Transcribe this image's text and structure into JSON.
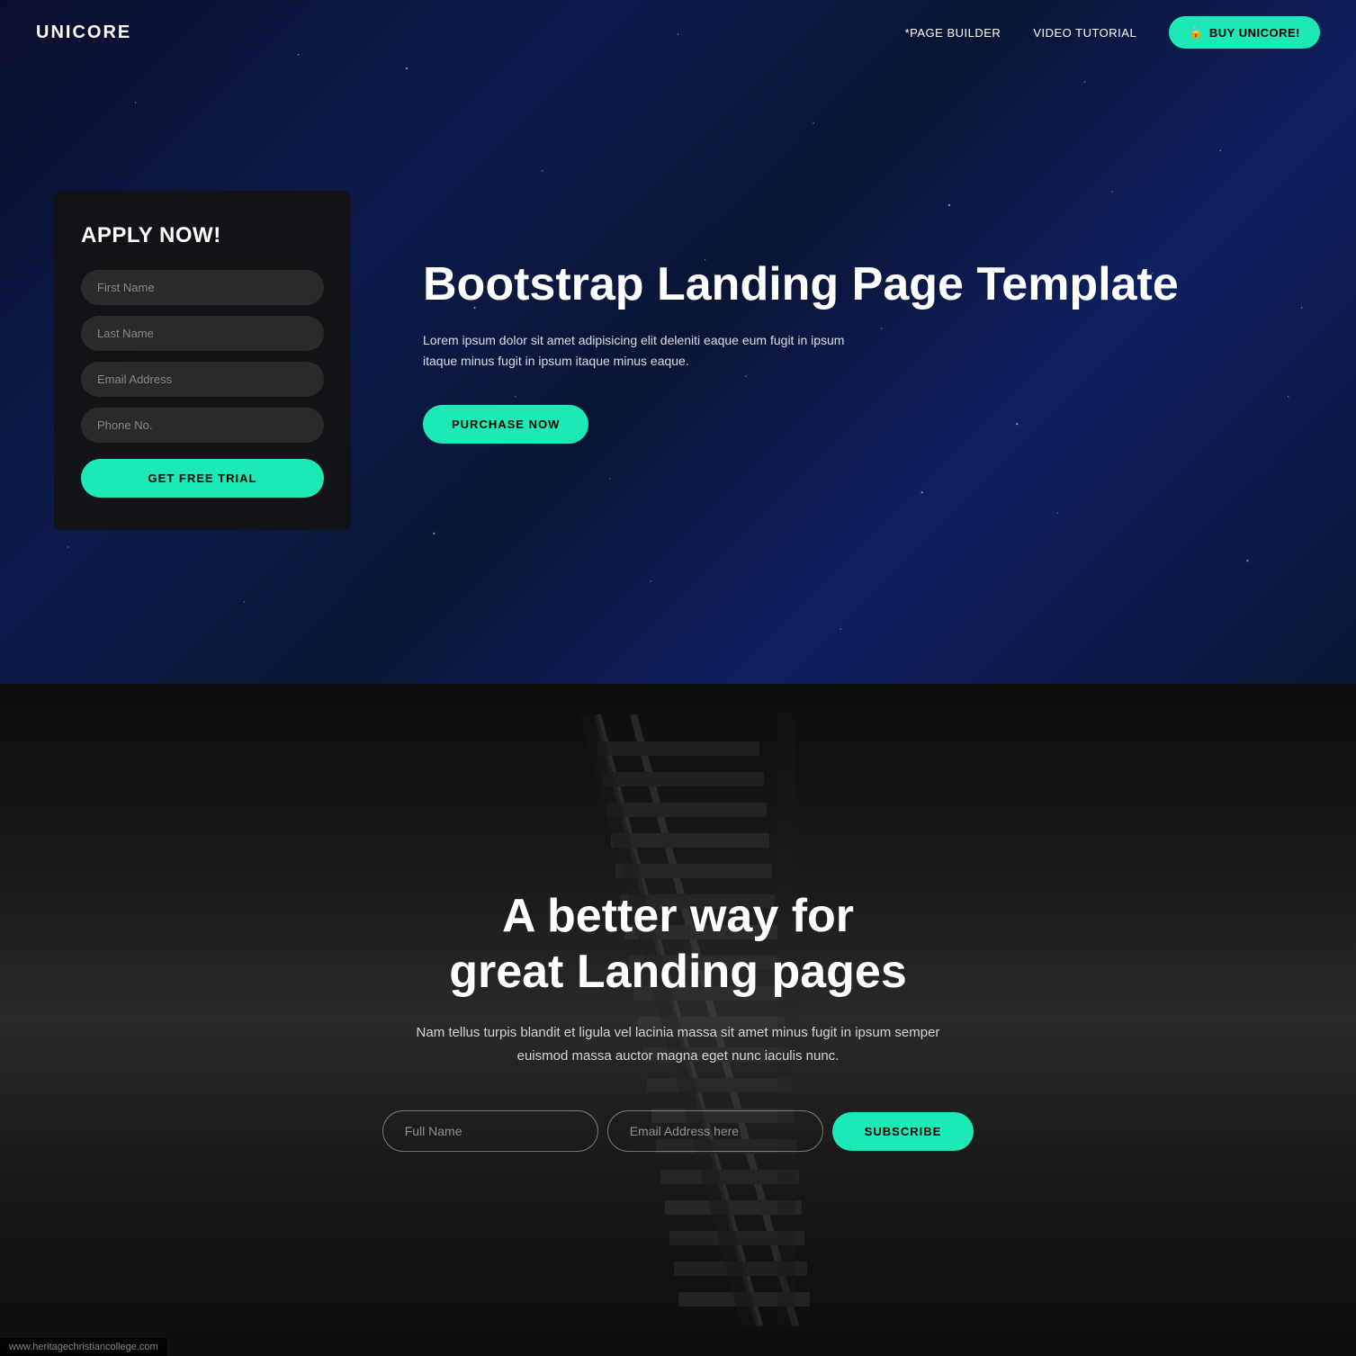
{
  "nav": {
    "logo": "UNICORE",
    "links": [
      {
        "label": "*PAGE BUILDER",
        "id": "page-builder"
      },
      {
        "label": "VIDEO TUTORIAL",
        "id": "video-tutorial"
      }
    ],
    "cta_icon": "🔒",
    "cta_label": "BUY UNICORE!"
  },
  "hero": {
    "form": {
      "title": "APPLY NOW!",
      "fields": [
        {
          "placeholder": "First Name",
          "id": "first-name"
        },
        {
          "placeholder": "Last Name",
          "id": "last-name"
        },
        {
          "placeholder": "Email Address",
          "id": "email"
        },
        {
          "placeholder": "Phone No.",
          "id": "phone"
        }
      ],
      "submit_label": "GET FREE TRIAL"
    },
    "heading": "Bootstrap Landing Page Template",
    "description": "Lorem ipsum dolor sit amet adipisicing elit deleniti eaque eum fugit in ipsum itaque minus fugit in ipsum itaque minus eaque.",
    "cta_label": "PURCHASE NOW"
  },
  "section2": {
    "heading_line1": "A better way for",
    "heading_line2": "great Landing pages",
    "description": "Nam tellus turpis blandit et ligula vel lacinia massa sit amet minus fugit in ipsum semper euismod massa auctor magna eget nunc iaculis nunc.",
    "form": {
      "name_placeholder": "Full Name",
      "email_placeholder": "Email Address here",
      "submit_label": "SUBSCRIBE"
    }
  },
  "statusbar": {
    "url": "www.heritagechristiancollege.com"
  },
  "colors": {
    "accent": "#1de9b6",
    "dark_bg": "#111111",
    "hero_text": "#ffffff",
    "form_bg": "rgba(20,20,20,0.92)"
  }
}
